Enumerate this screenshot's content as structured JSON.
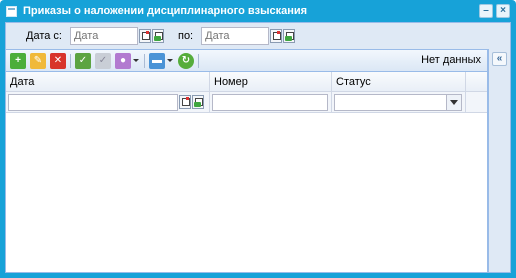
{
  "window": {
    "title": "Приказы о наложении дисциплинарного взыскания",
    "minimize_glyph": "–",
    "close_glyph": "×"
  },
  "filters": {
    "date_from_label": "Дата с:",
    "date_from_placeholder": "Дата",
    "date_to_label": "по:",
    "date_to_placeholder": "Дата"
  },
  "toolbar": {
    "add_icon": "add-icon",
    "edit_icon": "edit-icon",
    "delete_icon": "delete-icon",
    "approve_icon": "approve-icon",
    "disapprove_icon": "disapprove-icon",
    "print_icon": "print-icon",
    "export_icon": "export-icon",
    "refresh_icon": "refresh-icon",
    "status_text": "Нет данных"
  },
  "grid": {
    "columns": [
      {
        "label": "Дата"
      },
      {
        "label": "Номер"
      },
      {
        "label": "Статус"
      }
    ],
    "rows": []
  },
  "side_panel": {
    "collapse_glyph": "«"
  },
  "colors": {
    "window_frame": "#17a2d8",
    "panel_background": "#dfe9f5",
    "border": "#99bbe8"
  }
}
